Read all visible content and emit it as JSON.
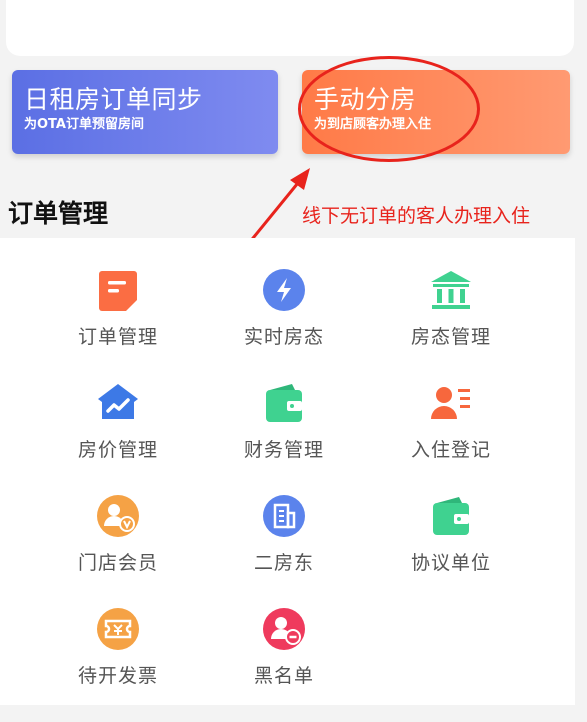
{
  "banners": {
    "left": {
      "title": "日租房订单同步",
      "subtitle": "为OTA订单预留房间"
    },
    "right": {
      "title": "手动分房",
      "subtitle": "为到店顾客办理入住"
    }
  },
  "section": {
    "title": "订单管理"
  },
  "annotation": {
    "text": "线下无订单的客人办理入住"
  },
  "grid": [
    {
      "label": "订单管理",
      "icon": "document-icon",
      "color": "#fb6d43"
    },
    {
      "label": "实时房态",
      "icon": "lightning-icon",
      "color": "#5b83ec"
    },
    {
      "label": "房态管理",
      "icon": "bank-icon",
      "color": "#3fd290"
    },
    {
      "label": "房价管理",
      "icon": "house-chart-icon",
      "color": "#3d79e6"
    },
    {
      "label": "财务管理",
      "icon": "wallet-icon",
      "color": "#3fd290"
    },
    {
      "label": "入住登记",
      "icon": "person-card-icon",
      "color": "#f7673d"
    },
    {
      "label": "门店会员",
      "icon": "member-icon",
      "color": "#f5a245"
    },
    {
      "label": "二房东",
      "icon": "building-icon",
      "color": "#5b83ec"
    },
    {
      "label": "协议单位",
      "icon": "wallet-icon",
      "color": "#3fd290"
    },
    {
      "label": "待开发票",
      "icon": "ticket-icon",
      "color": "#f5a245"
    },
    {
      "label": "黑名单",
      "icon": "blacklist-icon",
      "color": "#ef3a5d"
    }
  ]
}
